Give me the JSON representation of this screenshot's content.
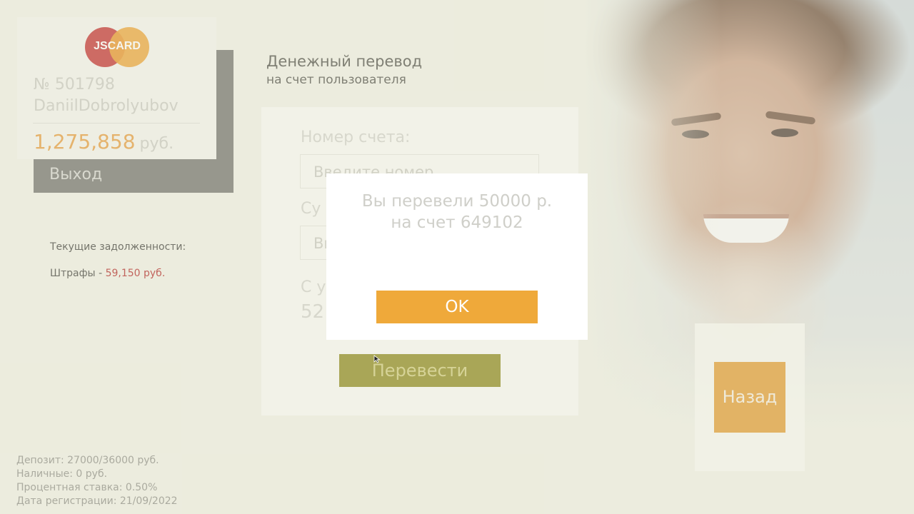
{
  "card": {
    "logo_text": "JSCARD",
    "number": "№ 501798",
    "holder": "DaniilDobrolyubov",
    "balance": "1,275,858",
    "currency": "руб."
  },
  "exit_label": "Выход",
  "debts": {
    "title": "Текущие задолженности:",
    "fines_label": "Штрафы - ",
    "fines_amount": "59,150 руб."
  },
  "footer": {
    "deposit": "Депозит: 27000/36000 руб.",
    "cash": "Наличные: 0 руб.",
    "rate": "Процентная ставка: 0.50%",
    "reg_date": "Дата регистрации: 21/09/2022"
  },
  "transfer": {
    "title": "Денежный перевод",
    "subtitle": "на счет пользователя",
    "account_label": "Номер счета:",
    "account_placeholder": "Введите номер",
    "sum_label": "Су",
    "sum_placeholder": "Вв",
    "from_label": "С у",
    "from_value": "52",
    "button_label": "Перевести"
  },
  "back_label": "Назад",
  "dialog": {
    "line1": "Вы перевели 50000 р.",
    "line2": "на счет 649102",
    "ok_label": "OK"
  },
  "colors": {
    "accent": "#efa93a",
    "fines": "#b02020",
    "balance": "#e69a3a"
  }
}
